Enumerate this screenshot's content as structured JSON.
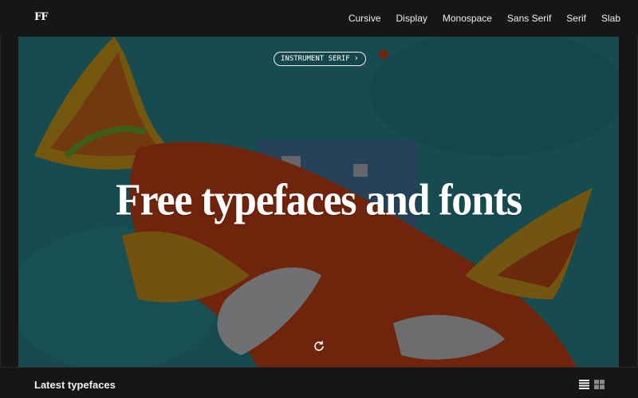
{
  "brand": {
    "logo": "FF"
  },
  "nav": {
    "items": [
      "Cursive",
      "Display",
      "Monospace",
      "Sans Serif",
      "Serif",
      "Slab"
    ]
  },
  "hero": {
    "featured_font": "INSTRUMENT SERIF",
    "headline": "Free typefaces and fonts",
    "colors": {
      "teal": "#2d9aa2",
      "orange": "#e04a1a",
      "yellow": "#e8b21e",
      "green": "#7ab83a"
    }
  },
  "section": {
    "title": "Latest typefaces"
  },
  "icons": [
    "list-view-icon",
    "grid-view-icon",
    "reload-icon",
    "chevron-right-icon"
  ]
}
